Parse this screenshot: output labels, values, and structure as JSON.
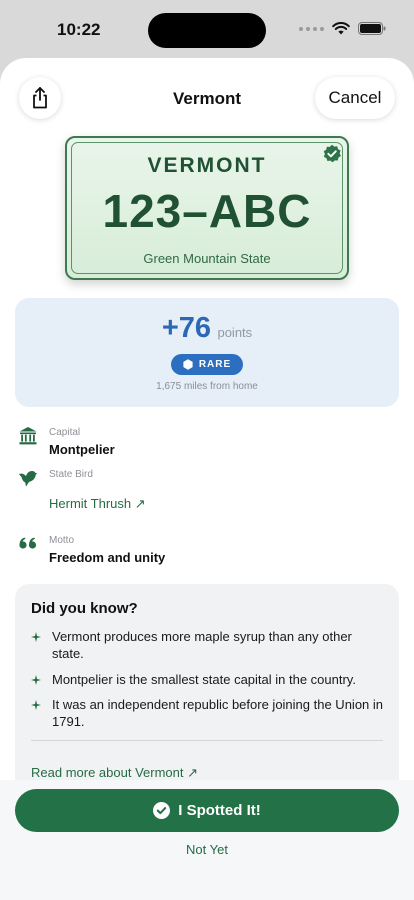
{
  "status_bar": {
    "time": "10:22"
  },
  "nav": {
    "title": "Vermont",
    "cancel_label": "Cancel"
  },
  "plate": {
    "state": "VERMONT",
    "number": "123–ABC",
    "slogan": "Green Mountain State",
    "accent_color": "#1f5132"
  },
  "points": {
    "value": "+76",
    "label": "points",
    "rarity": "RARE",
    "distance": "1,675 miles from home",
    "accent_color": "#2c69b5"
  },
  "facts": [
    {
      "label": "Capital",
      "value": "Montpelier",
      "icon": "capitol-building-icon"
    },
    {
      "label": "State Bird",
      "value": "Hermit Thrush ↗",
      "icon": "bird-icon"
    },
    {
      "label": "Motto",
      "value": "Freedom and unity",
      "icon": "quote-icon"
    }
  ],
  "did_you_know": {
    "title": "Did you know?",
    "items": [
      "Vermont produces more maple syrup than any other state.",
      "Montpelier is the smallest state capital in the country.",
      "It was an independent republic before joining the Union in 1791."
    ],
    "read_more": "Read more about Vermont ↗"
  },
  "actions": {
    "spotted_label": "I Spotted It!",
    "not_yet_label": "Not Yet",
    "brand_color": "#227147"
  }
}
